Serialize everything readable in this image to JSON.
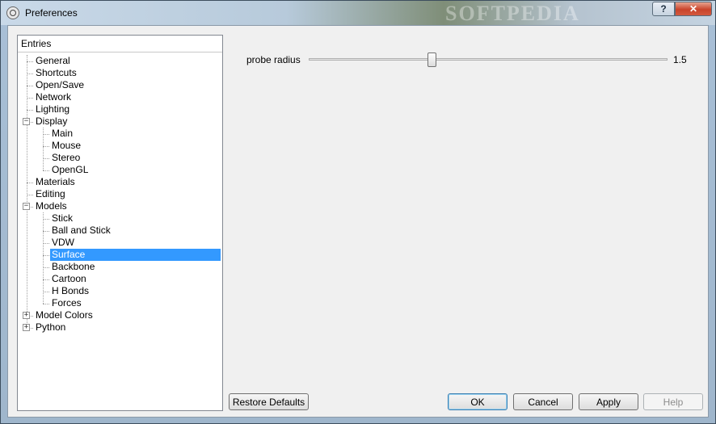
{
  "window": {
    "title": "Preferences",
    "watermark": "SOFTPEDIA",
    "help_glyph": "?",
    "close_glyph": "✕"
  },
  "tree": {
    "header": "Entries",
    "items": [
      {
        "label": "General",
        "level": 1
      },
      {
        "label": "Shortcuts",
        "level": 1
      },
      {
        "label": "Open/Save",
        "level": 1
      },
      {
        "label": "Network",
        "level": 1
      },
      {
        "label": "Lighting",
        "level": 1
      },
      {
        "label": "Display",
        "level": 1,
        "expander": "−"
      },
      {
        "label": "Main",
        "level": 2
      },
      {
        "label": "Mouse",
        "level": 2
      },
      {
        "label": "Stereo",
        "level": 2
      },
      {
        "label": "OpenGL",
        "level": 2
      },
      {
        "label": "Materials",
        "level": 1
      },
      {
        "label": "Editing",
        "level": 1
      },
      {
        "label": "Models",
        "level": 1,
        "expander": "−"
      },
      {
        "label": "Stick",
        "level": 2
      },
      {
        "label": "Ball and Stick",
        "level": 2
      },
      {
        "label": "VDW",
        "level": 2
      },
      {
        "label": "Surface",
        "level": 2,
        "selected": true
      },
      {
        "label": "Backbone",
        "level": 2
      },
      {
        "label": "Cartoon",
        "level": 2
      },
      {
        "label": "H Bonds",
        "level": 2
      },
      {
        "label": "Forces",
        "level": 2
      },
      {
        "label": "Model Colors",
        "level": 1,
        "expander": "+"
      },
      {
        "label": "Python",
        "level": 1,
        "expander": "+"
      }
    ]
  },
  "settings": {
    "probe_radius": {
      "label": "probe radius",
      "value": "1.5",
      "slider_fraction": 0.34
    }
  },
  "buttons": {
    "restore_defaults": "Restore Defaults",
    "ok": "OK",
    "cancel": "Cancel",
    "apply": "Apply",
    "help": "Help"
  },
  "colors": {
    "selection": "#3399ff",
    "close_button": "#c9442b"
  }
}
